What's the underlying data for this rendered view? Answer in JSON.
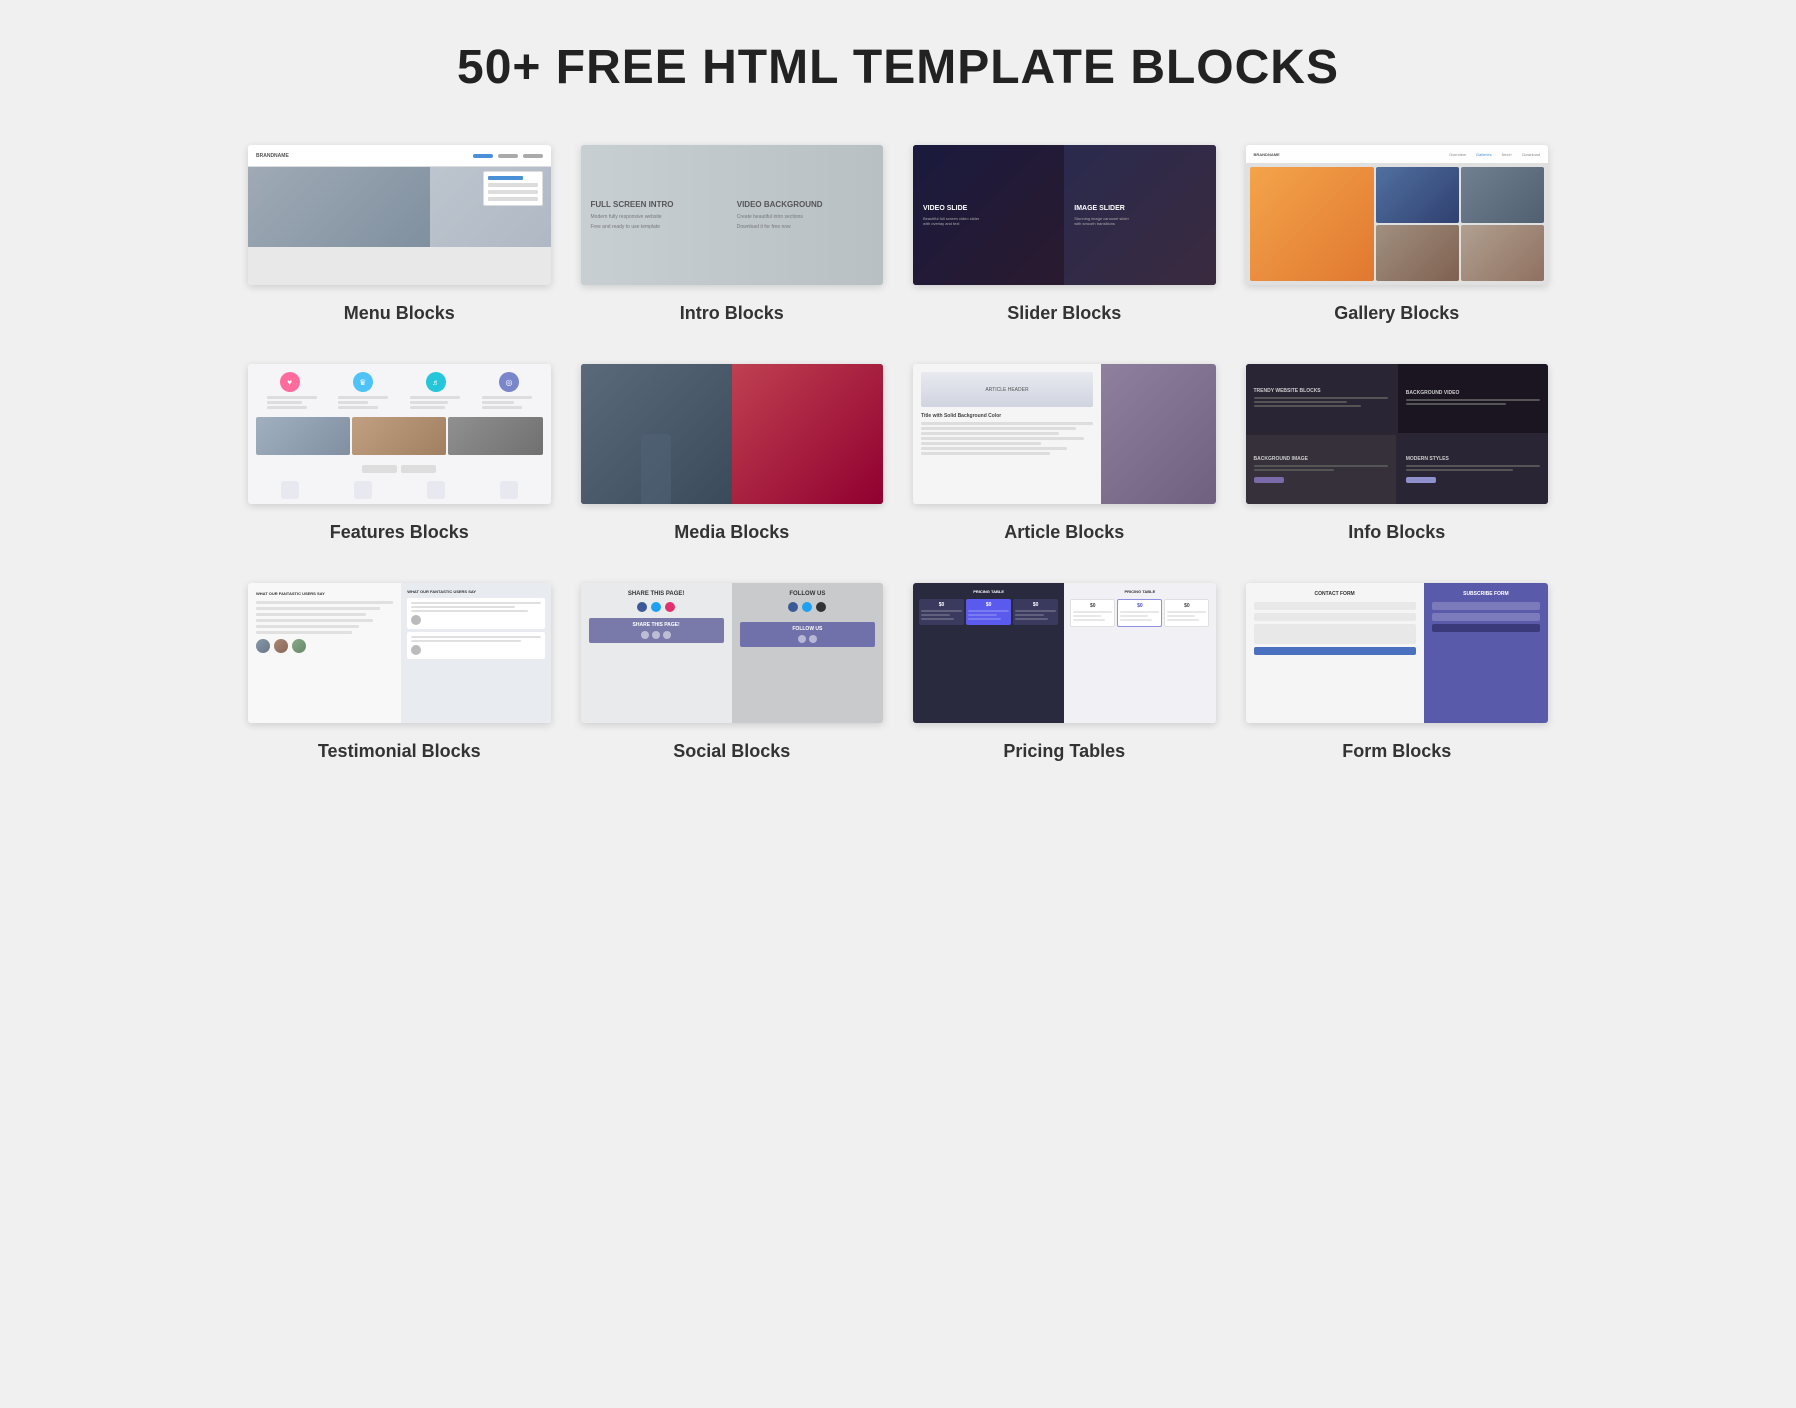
{
  "page": {
    "title": "50+ FREE HTML TEMPLATE BLOCKS"
  },
  "blocks": [
    {
      "id": "menu",
      "label": "Menu Blocks",
      "thumbnail_type": "menu"
    },
    {
      "id": "intro",
      "label": "Intro Blocks",
      "thumbnail_type": "intro"
    },
    {
      "id": "slider",
      "label": "Slider Blocks",
      "thumbnail_type": "slider"
    },
    {
      "id": "gallery",
      "label": "Gallery Blocks",
      "thumbnail_type": "gallery"
    },
    {
      "id": "features",
      "label": "Features Blocks",
      "thumbnail_type": "features"
    },
    {
      "id": "media",
      "label": "Media Blocks",
      "thumbnail_type": "media"
    },
    {
      "id": "article",
      "label": "Article Blocks",
      "thumbnail_type": "article"
    },
    {
      "id": "info",
      "label": "Info Blocks",
      "thumbnail_type": "info"
    },
    {
      "id": "testimonial",
      "label": "Testimonial Blocks",
      "thumbnail_type": "testimonial"
    },
    {
      "id": "social",
      "label": "Social Blocks",
      "thumbnail_type": "social"
    },
    {
      "id": "pricing",
      "label": "Pricing Tables",
      "thumbnail_type": "pricing"
    },
    {
      "id": "form",
      "label": "Form Blocks",
      "thumbnail_type": "form"
    }
  ],
  "slider_content": {
    "left_title": "VIDEO SLIDE",
    "right_title": "IMAGE SLIDER"
  },
  "intro_content": {
    "left_title": "FULL SCREEN INTRO",
    "right_title": "VIDEO BACKGROUND"
  },
  "article_content": {
    "header": "ARTICLE HEADER",
    "subtitle": "Title with Solid Background Color"
  },
  "info_content": {
    "cell1": "TRENDY WEBSITE BLOCKS",
    "cell2": "BACKGROUND VIDEO",
    "cell3": "BACKGROUND IMAGE",
    "cell4": "MODERN STYLES"
  },
  "gallery_content": {
    "label": "Gallery Blocks"
  }
}
